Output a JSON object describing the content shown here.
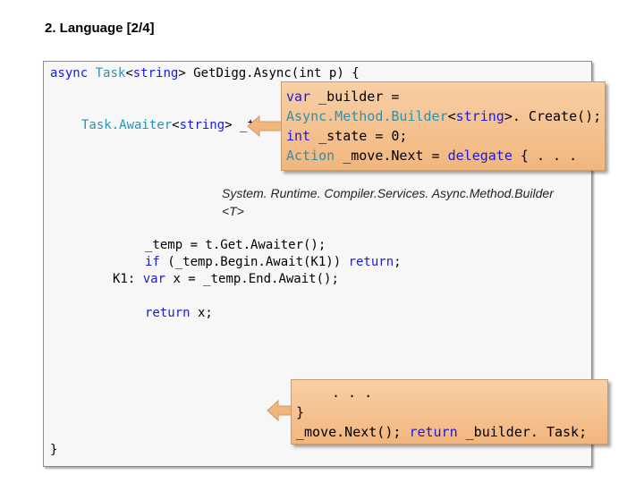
{
  "slide": {
    "title": "2. Language [2/4]"
  },
  "code": {
    "sig_async": "async",
    "sig_task": "Task",
    "sig_lt1": "<",
    "sig_string": "string",
    "sig_rest": "> GetDigg.Async(int p) {",
    "awaiter_type": "Task.Awaiter",
    "awaiter_lt": "<",
    "awaiter_string": "string",
    "awaiter_rest": "> _tem",
    "temp_line": "_temp = t.Get.Awaiter();",
    "if_kw": "if",
    "if_rest": " (_temp.Begin.Await(K1)) ",
    "if_return": "return",
    "if_semi": ";",
    "k1_label": "K1: ",
    "k1_var": "var",
    "k1_rest": " x = _temp.End.Await();",
    "return_kw": "return",
    "return_rest": " x;",
    "closing_brace": "}"
  },
  "callout_top": {
    "l1_kw": "var",
    "l1_rest": " _builder =",
    "l2_type": "Async.Method.Builder",
    "l2_lt": "<",
    "l2_string": "string",
    "l2_rest": ">. Create();",
    "l3_kw": "int",
    "l3_rest": " _state = 0;",
    "l4_type": "Action",
    "l4_mid": " _move.Next = ",
    "l4_kw": "delegate",
    "l4_rest": " { . . ."
  },
  "note": {
    "line1": "System. Runtime. Compiler.Services. Async.Method.Builder",
    "line2": "<T>"
  },
  "callout_bottom": {
    "l1": ". . .",
    "l2": "}",
    "l3_a": "_move.Next(); ",
    "l3_kw": "return",
    "l3_b": " _builder. Task;"
  },
  "colors": {
    "callout_fill": "#f6c797",
    "keyword": "#1a1adc",
    "type": "#2b91af",
    "arrow": "#f2b67d"
  }
}
